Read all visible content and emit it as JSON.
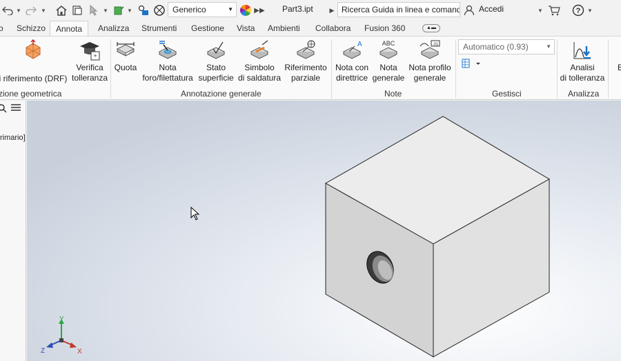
{
  "qat": {
    "appearance_value": "Generico",
    "document_title": "Part3.ipt",
    "search_text": "Ricerca Guida in linea e comand",
    "sign_in": "Accedi"
  },
  "tabs": [
    {
      "label": "Schizzo"
    },
    {
      "label": "Annota",
      "active": true
    },
    {
      "label": "Analizza"
    },
    {
      "label": "Strumenti"
    },
    {
      "label": "Gestione"
    },
    {
      "label": "Vista"
    },
    {
      "label": "Ambienti"
    },
    {
      "label": "Collabora"
    },
    {
      "label": "Fusion 360"
    }
  ],
  "ribbon": {
    "gdt_panel": {
      "label": "zione geometrica",
      "buttons": [
        {
          "label": "i riferimento (DRF)"
        },
        {
          "label_1": "Verifica",
          "label_2": "tolleranza"
        }
      ]
    },
    "annotation_panel": {
      "label": "Annotazione generale",
      "buttons": [
        {
          "label_1": "Quota",
          "label_2": ""
        },
        {
          "label_1": "Nota",
          "label_2": "foro/filettatura"
        },
        {
          "label_1": "Stato",
          "label_2": "superficie"
        },
        {
          "label_1": "Simbolo",
          "label_2": "di saldatura"
        },
        {
          "label_1": "Riferimento",
          "label_2": "parziale"
        }
      ]
    },
    "note_panel": {
      "label": "Note",
      "buttons": [
        {
          "label_1": "Nota con",
          "label_2": "direttrice"
        },
        {
          "label_1": "Nota",
          "label_2": "generale"
        },
        {
          "label_1": "Nota profilo",
          "label_2": "generale"
        }
      ]
    },
    "manage_panel": {
      "label": "Gestisci",
      "style_value": "Automatico (0.93)"
    },
    "analyze_panel": {
      "label": "Analizza",
      "buttons": [
        {
          "label_1": "Analisi",
          "label_2": "di tolleranza"
        }
      ]
    }
  },
  "browser": {
    "node_text": "rimario]"
  },
  "icons": {
    "undo": "undo-icon",
    "redo": "redo-icon",
    "home": "home-icon",
    "cart": "cart-icon",
    "help": "help-icon"
  },
  "triad": {
    "x": "X",
    "y": "Y",
    "z": "Z"
  },
  "colors": {
    "accent_blue": "#1a73c9",
    "tab_active_bg": "#fafafa",
    "triad_x": "#c0392b",
    "triad_y": "#27a744",
    "triad_z": "#2a4fb8"
  }
}
